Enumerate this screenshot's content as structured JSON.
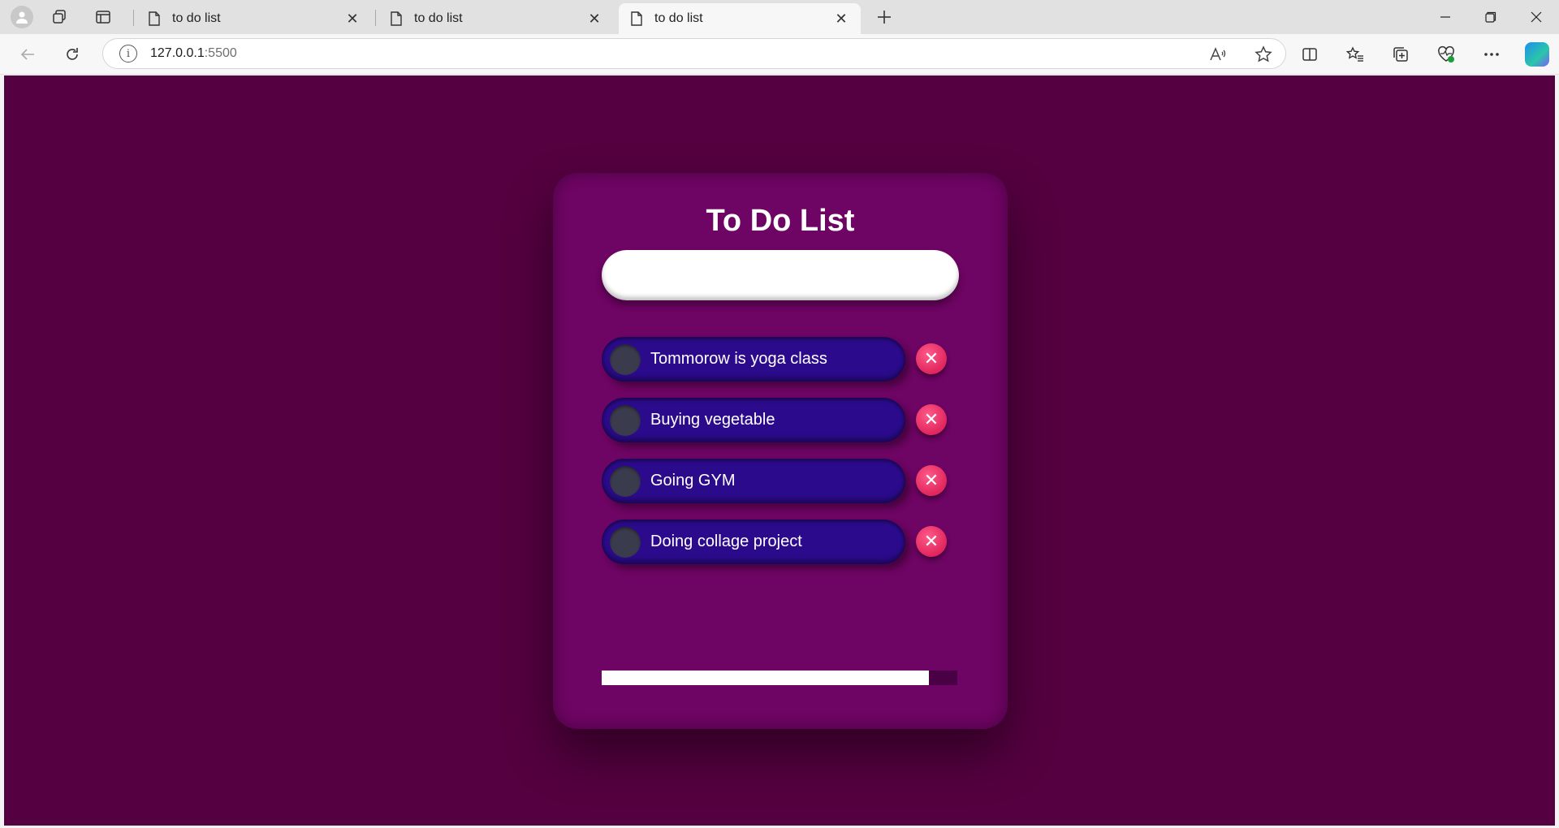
{
  "browser": {
    "tabs": [
      {
        "title": "to do list",
        "active": false
      },
      {
        "title": "to do list",
        "active": false
      },
      {
        "title": "to do list",
        "active": true
      }
    ],
    "url": {
      "host": "127.0.0.1",
      "port": ":5500"
    }
  },
  "app": {
    "title": "To Do List",
    "input": {
      "value": "",
      "placeholder": ""
    },
    "todos": [
      {
        "text": "Tommorow is yoga class"
      },
      {
        "text": "Buying vegetable"
      },
      {
        "text": "Going GYM"
      },
      {
        "text": "Doing collage project"
      }
    ],
    "delete_symbol": "✕",
    "progress": {
      "fraction": 0.92
    },
    "colors": {
      "background": "#550040",
      "card": "#6e0463",
      "todo_pill": "#2b0b8c",
      "delete": "#e0265d"
    }
  }
}
